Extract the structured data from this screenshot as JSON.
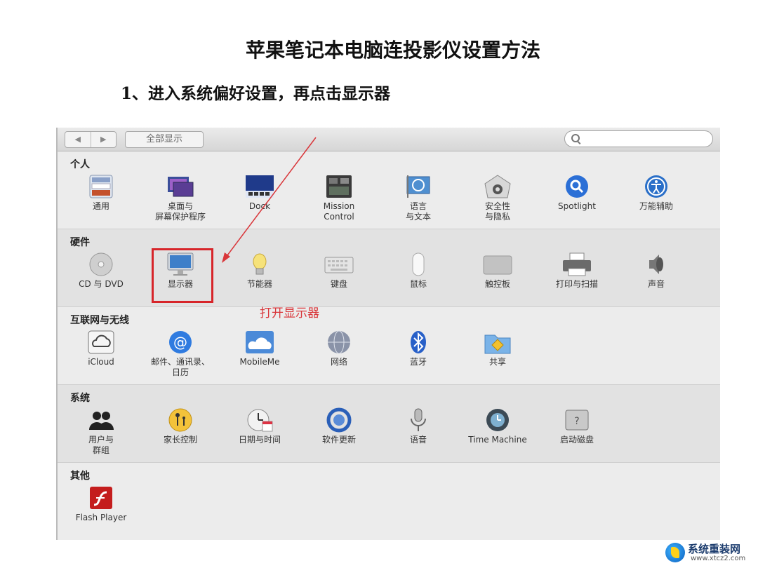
{
  "title": "苹果笔记本电脑连投影仪设置方法",
  "step": "1、进入系统偏好设置，再点击显示器",
  "toolbar": {
    "back": "◀",
    "forward": "▶",
    "show_all": "全部显示"
  },
  "sections": [
    {
      "title": "个人",
      "items": [
        {
          "label": "通用",
          "icon": "general-icon"
        },
        {
          "label": "桌面与\n屏幕保护程序",
          "icon": "desktop-icon"
        },
        {
          "label": "Dock",
          "icon": "dock-icon"
        },
        {
          "label": "Mission\nControl",
          "icon": "mission-control-icon"
        },
        {
          "label": "语言\n与文本",
          "icon": "language-icon"
        },
        {
          "label": "安全性\n与隐私",
          "icon": "security-icon"
        },
        {
          "label": "Spotlight",
          "icon": "spotlight-icon"
        },
        {
          "label": "万能辅助",
          "icon": "accessibility-icon"
        }
      ]
    },
    {
      "title": "硬件",
      "items": [
        {
          "label": "CD 与 DVD",
          "icon": "cd-dvd-icon"
        },
        {
          "label": "显示器",
          "icon": "display-icon"
        },
        {
          "label": "节能器",
          "icon": "energy-saver-icon"
        },
        {
          "label": "键盘",
          "icon": "keyboard-icon"
        },
        {
          "label": "鼠标",
          "icon": "mouse-icon"
        },
        {
          "label": "触控板",
          "icon": "trackpad-icon"
        },
        {
          "label": "打印与扫描",
          "icon": "printer-icon"
        },
        {
          "label": "声音",
          "icon": "sound-icon"
        }
      ]
    },
    {
      "title": "互联网与无线",
      "items": [
        {
          "label": "iCloud",
          "icon": "icloud-icon"
        },
        {
          "label": "邮件、通讯录、\n日历",
          "icon": "mail-icon"
        },
        {
          "label": "MobileMe",
          "icon": "mobileme-icon"
        },
        {
          "label": "网络",
          "icon": "network-icon"
        },
        {
          "label": "蓝牙",
          "icon": "bluetooth-icon"
        },
        {
          "label": "共享",
          "icon": "sharing-icon"
        }
      ]
    },
    {
      "title": "系统",
      "items": [
        {
          "label": "用户与\n群组",
          "icon": "users-icon"
        },
        {
          "label": "家长控制",
          "icon": "parental-controls-icon"
        },
        {
          "label": "日期与时间",
          "icon": "date-time-icon"
        },
        {
          "label": "软件更新",
          "icon": "software-update-icon"
        },
        {
          "label": "语音",
          "icon": "speech-icon"
        },
        {
          "label": "Time Machine",
          "icon": "time-machine-icon"
        },
        {
          "label": "启动磁盘",
          "icon": "startup-disk-icon"
        }
      ]
    },
    {
      "title": "其他",
      "items": [
        {
          "label": "Flash Player",
          "icon": "flash-player-icon"
        }
      ]
    }
  ],
  "annotation": {
    "text": "打开显示器",
    "color": "#d9363a"
  },
  "watermark": {
    "name": "系统重装网",
    "url": "www.xtcz2.com"
  }
}
